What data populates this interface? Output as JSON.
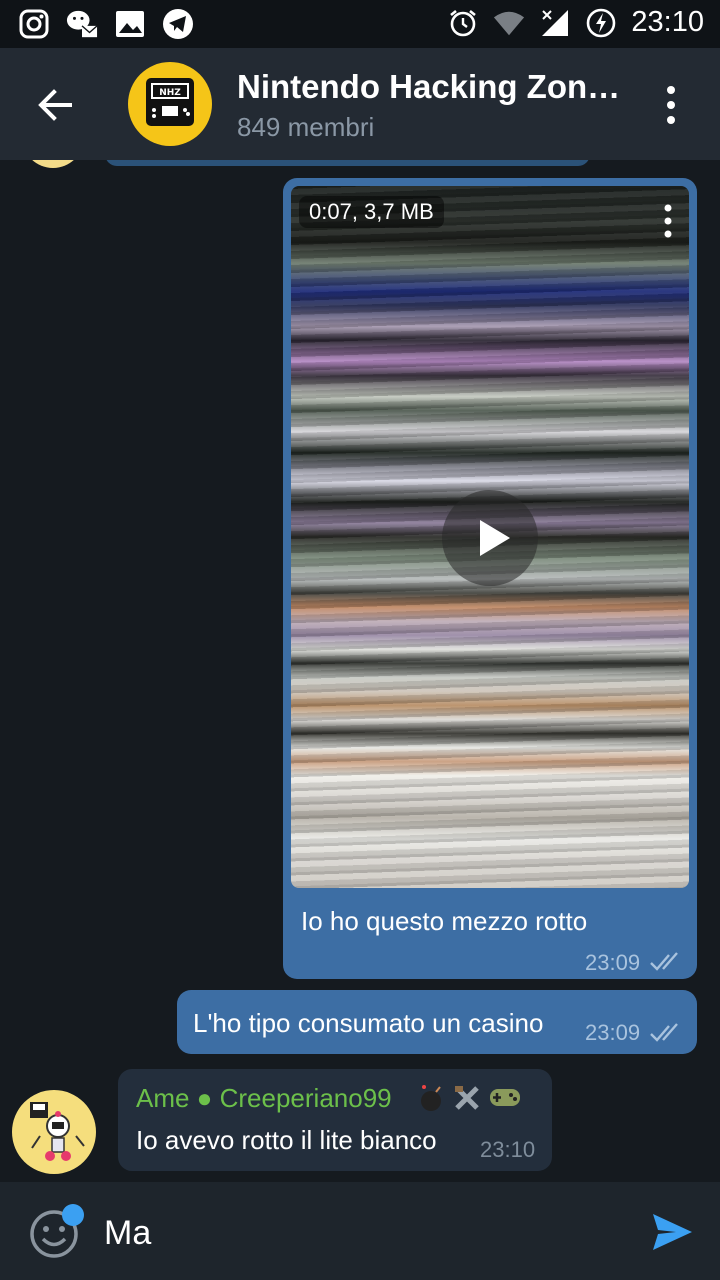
{
  "status_bar": {
    "left_icons": [
      "instagram-icon",
      "wechat-icon",
      "gallery-icon",
      "telegram-icon"
    ],
    "right_icons": [
      "alarm-icon",
      "wifi-icon",
      "signal-icon",
      "battery-charging-icon"
    ],
    "time": "23:10"
  },
  "header": {
    "title": "Nintendo Hacking Zon…",
    "subtitle": "849 membri",
    "avatar_text": "NHZ"
  },
  "messages": {
    "video": {
      "info": "0:07, 3,7 MB",
      "caption": "Io ho questo mezzo rotto",
      "time": "23:09"
    },
    "outgoing_text": {
      "text": "L'ho tipo consumato un casino",
      "time": "23:09"
    },
    "incoming": {
      "sender": "Ame ● Creeperiano99",
      "text": "Io avevo rotto il lite bianco",
      "time": "23:10"
    }
  },
  "input": {
    "value": "Ma"
  },
  "colors": {
    "background": "#151a1f",
    "header": "#232a33",
    "outgoing_bubble": "#3d6ea4",
    "incoming_bubble": "#232e3c",
    "sender_name": "#6cc04a",
    "send_accent": "#3ba0f2"
  }
}
